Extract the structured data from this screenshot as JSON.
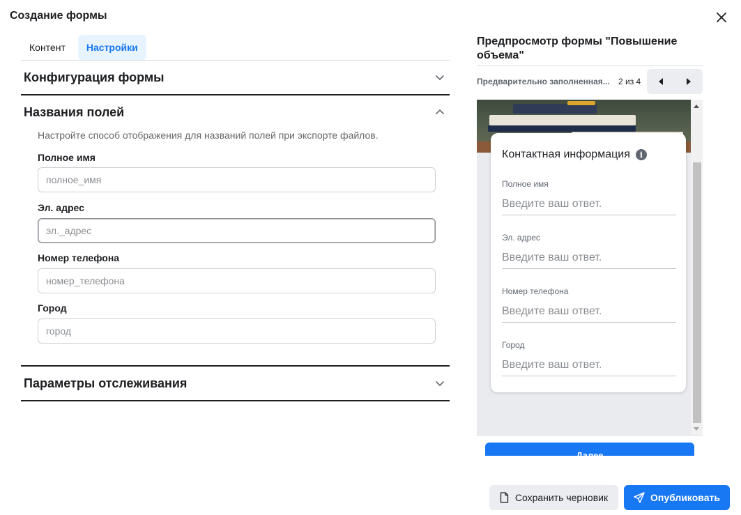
{
  "dialog": {
    "title": "Создание формы"
  },
  "tabs": [
    {
      "label": "Контент",
      "active": false
    },
    {
      "label": "Настройки",
      "active": true
    }
  ],
  "sections": {
    "form_config": {
      "title": "Конфигурация формы",
      "expanded": false
    },
    "field_names": {
      "title": "Названия полей",
      "expanded": true,
      "hint": "Настройте способ отображения для названий полей при экспорте файлов.",
      "fields": [
        {
          "label": "Полное имя",
          "placeholder": "полное_имя"
        },
        {
          "label": "Эл. адрес",
          "placeholder": "эл._адрес"
        },
        {
          "label": "Номер телефона",
          "placeholder": "номер_телефона"
        },
        {
          "label": "Город",
          "placeholder": "город"
        }
      ]
    },
    "tracking": {
      "title": "Параметры отслеживания",
      "expanded": false
    }
  },
  "preview": {
    "title": "Предпросмотр формы \"Повышение объема\"",
    "nav_label": "Предварительно заполненная...",
    "page_count": "2 из 4",
    "card": {
      "title": "Контактная информация",
      "fields": [
        {
          "label": "Полное имя",
          "placeholder": "Введите ваш ответ."
        },
        {
          "label": "Эл. адрес",
          "placeholder": "Введите ваш ответ."
        },
        {
          "label": "Номер телефона",
          "placeholder": "Введите ваш ответ."
        },
        {
          "label": "Город",
          "placeholder": "Введите ваш ответ."
        }
      ]
    },
    "next_button": "Далее"
  },
  "footer": {
    "save_draft": "Сохранить черновик",
    "publish": "Опубликовать"
  },
  "colors": {
    "accent": "#1877f2",
    "tab_active_bg": "#e7f3ff",
    "secondary_button_bg": "#ebedf0"
  }
}
